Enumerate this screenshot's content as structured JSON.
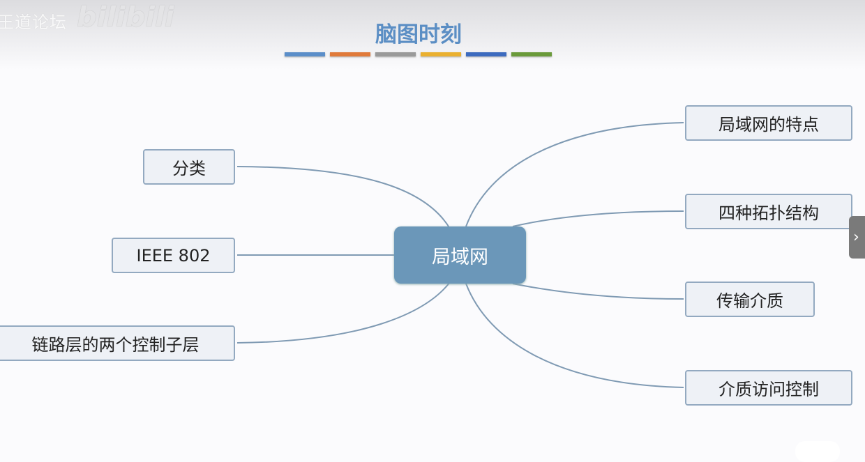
{
  "watermark": {
    "site": "王道论坛",
    "brand": "bilibili"
  },
  "title": "脑图时刻",
  "title_color": "#5b8ec4",
  "color_bars": [
    "#5b8ec9",
    "#e07a3a",
    "#9a9a9a",
    "#eab030",
    "#3d6bbf",
    "#6a9a3a"
  ],
  "center": {
    "label": "局域网"
  },
  "left_nodes": [
    {
      "label": "分类"
    },
    {
      "label": "IEEE 802"
    },
    {
      "label": "链路层的两个控制子层"
    }
  ],
  "right_nodes": [
    {
      "label": "局域网的特点"
    },
    {
      "label": "四种拓扑结构"
    },
    {
      "label": "传输介质"
    },
    {
      "label": "介质访问控制"
    }
  ],
  "nav": {
    "next_icon": "chevron-right-icon"
  }
}
